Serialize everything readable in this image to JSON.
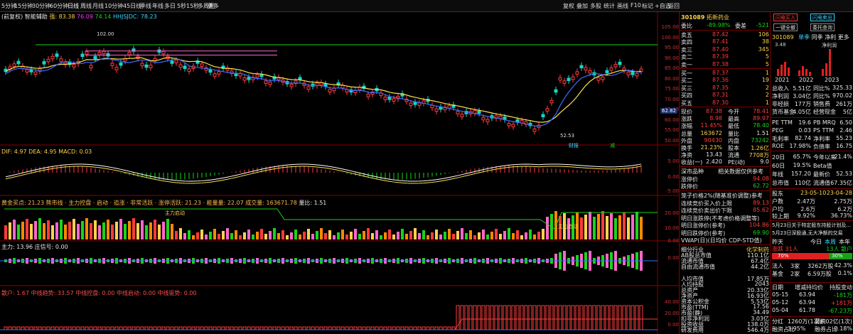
{
  "toolbar": {
    "periods": [
      "5分钟",
      "15分钟",
      "30分钟",
      "60分钟",
      "日线",
      "周线",
      "月线",
      "10分钟",
      "45日线",
      "季线",
      "年线",
      "多日",
      "5秒",
      "15秒",
      "多周期",
      "更多"
    ],
    "right": [
      "复权",
      "叠加",
      "多股",
      "统计",
      "画线",
      "F10",
      "标记",
      "+自选",
      "返回"
    ]
  },
  "header": {
    "title": "(前复权) 智能辅助",
    "ind1": "强: 83.38",
    "ind2": "76.09",
    "ind3": "74.14",
    "ind4": "HHJSJDC: 78.23"
  },
  "price_axis": [
    "105.00",
    "100.00",
    "95.00",
    "90.00",
    "85.00",
    "80.00",
    "75.00",
    "70.00",
    "65.00",
    "60.00",
    "55.00",
    "50.00"
  ],
  "price_marker": "62.82",
  "annotations": {
    "hi": "102.00",
    "lo": "52.53",
    "t1": "财报",
    "t2": "减"
  },
  "macd": {
    "label": "DIF: 4.97  DEA: 4.95  MACD: 0.03",
    "axis": [
      "5.00",
      "0.00",
      "-5.00"
    ]
  },
  "pane3": {
    "label": "黄金买点: 21.23  熊市线 · 主力控盘 · 启动 · 追涨 · 非常活跃 · 涨停活跃: 21.23 · 能量量: 22.07  成交量: 163671.78",
    "extra": "量比: 1.51",
    "axis": [
      "20.00",
      "10.00",
      "0.00"
    ],
    "tag1": "主力启动",
    "tag2": "主力启动"
  },
  "pane4": {
    "label": "主力: 13.96  庄信号: 0.00",
    "axis": [
      "0.00"
    ]
  },
  "pane5": {
    "label": "散户: 1.67  中线趋势: 33.57  中线控盘: 0.00  中线启动: 0.00  中线驱势: 0.00",
    "axis": [
      "40.00",
      "20.00",
      "0.00"
    ]
  },
  "rp": {
    "top_buttons": [
      "闪电买入",
      "闪电卖出",
      "一键全撤",
      "委托查询"
    ],
    "code": "301089",
    "name": "拓新药业",
    "weibi": {
      "label": "委比",
      "val": "-89.98%",
      "label2": "委差",
      "val2": "-521"
    },
    "asks": [
      {
        "lbl": "卖五",
        "p": "87.42",
        "v": "106"
      },
      {
        "lbl": "卖四",
        "p": "87.41",
        "v": "38"
      },
      {
        "lbl": "卖三",
        "p": "87.40",
        "v": "345"
      },
      {
        "lbl": "卖二",
        "p": "87.39",
        "v": "5"
      },
      {
        "lbl": "卖一",
        "p": "87.38",
        "v": "5"
      }
    ],
    "bids": [
      {
        "lbl": "买一",
        "p": "87.37",
        "v": "1"
      },
      {
        "lbl": "买二",
        "p": "87.36",
        "v": "19"
      },
      {
        "lbl": "买三",
        "p": "87.35",
        "v": "2"
      },
      {
        "lbl": "买四",
        "p": "87.31",
        "v": "2"
      },
      {
        "lbl": "买五",
        "p": "87.30",
        "v": "1"
      }
    ],
    "quote": [
      [
        "现价",
        "87.38",
        "今开",
        "78.41"
      ],
      [
        "涨跌",
        "8.98",
        "最高",
        "89.97"
      ],
      [
        "涨幅",
        "11.45%",
        "最低",
        "78.40"
      ],
      [
        "总量",
        "163672",
        "量比",
        "1.51"
      ],
      [
        "外盘",
        "90430",
        "内盘",
        "73242"
      ],
      [
        "换手",
        "21.23%",
        "股本",
        "1.26亿"
      ],
      [
        "净资",
        "13.43",
        "流通",
        "7708万"
      ],
      [
        "收益(一)",
        "2.420",
        "PE(动)",
        "9.0"
      ]
    ],
    "sz_label": "深市品种",
    "sz_note": "相关数据仅供参考",
    "limit_up_lbl": "涨停价",
    "limit_up": "94.08",
    "limit_dn_lbl": "跌停价",
    "limit_dn": "62.72",
    "auction": [
      [
        "笼子价格2%(随基准价调整)参考",
        ""
      ],
      [
        "连续竞价买入价上限",
        "89.13"
      ],
      [
        "连续竞价卖出价下限",
        "85.62"
      ],
      [
        "明日涨跌停(不考虑价格调整等)",
        ""
      ],
      [
        "明日涨停价(参考)",
        "104.86"
      ],
      [
        "明日跌停价(参考)",
        "69.90"
      ],
      [
        "VWAP(日)(日均价 CDP-STD值)",
        ""
      ]
    ],
    "industry": [
      [
        "细分行业",
        "化学制药"
      ],
      [
        "AB股总市值",
        "110.1亿"
      ],
      [
        "流通市值",
        "67.4亿"
      ],
      [
        "自由流通市值",
        "44.2亿"
      ],
      [
        "",
        ""
      ],
      [
        "人均市值",
        "17.85万"
      ],
      [
        "人均持股",
        "2043"
      ],
      [
        "总资产",
        "20.33亿"
      ],
      [
        "净资产",
        "16.93亿"
      ],
      [
        "资本公积金",
        "5.53亿"
      ],
      [
        "市盈(TTM)",
        "17.56"
      ],
      [
        "市盈(静)",
        "34.49"
      ],
      [
        "扣非净利润",
        "3.03亿"
      ],
      [
        "投资收益",
        "138.0万"
      ],
      [
        "研发费用",
        "546.4万"
      ]
    ],
    "fin_tabs": [
      "单季",
      "同季",
      "净利",
      "更多"
    ],
    "bar_labels": [
      "3.48",
      "净利润"
    ],
    "years": [
      "2021",
      "2022",
      "2023"
    ],
    "fin": [
      [
        "总收入",
        "5.51亿",
        "同比%",
        "325.33"
      ],
      [
        "净利润",
        "3.04亿",
        "同比%",
        "970.02"
      ],
      [
        "非经损",
        "177万",
        "销售费",
        "261万"
      ],
      [
        "货币基金",
        "4.05亿",
        "经营现金",
        "5亿"
      ]
    ],
    "fin2": [
      [
        "PE TTM",
        "19.6",
        "PB MRQ",
        "6.50"
      ],
      [
        "PEG",
        "0.03",
        "PS TTM",
        "2.46"
      ],
      [
        "毛利率",
        "82.74",
        "净利率",
        "55.23"
      ],
      [
        "ROE",
        "17.98%",
        "负债率",
        "16.75"
      ]
    ],
    "perf": [
      [
        "20日",
        "65.7%",
        "今年以来",
        "21.4%"
      ],
      [
        "60日",
        "19.5%",
        "Beta值",
        ""
      ],
      [
        "年线",
        "157.20",
        "最新价",
        "52.53"
      ],
      [
        "总市值",
        "110亿",
        "流通值",
        "67.35亿"
      ]
    ],
    "holders_hdr": [
      "股东",
      "23-05-10",
      "23-04-28"
    ],
    "holders": [
      [
        "户数",
        "2.47万",
        "2.75万"
      ],
      [
        "户均",
        "2.6万",
        "6.2万"
      ],
      [
        "较上期",
        "9.92%",
        "36.73%"
      ]
    ],
    "news": [
      "5月23日关于特定股东持股计划及...",
      "5月23日深股通,无大净额的交易"
    ],
    "flow_tabs": [
      "昨天",
      "今日",
      "本周",
      "本年"
    ],
    "flow_up": "涨跌 31人",
    "flow_dn": "13人 散户",
    "flow_pct_l": "70%",
    "flow_pct_r": "30%",
    "fund1": [
      "法人",
      "3家",
      "3262万股",
      "42.3%"
    ],
    "fund2": [
      "基金",
      "2家",
      "6.59万股",
      "0.1%"
    ],
    "trade_hdr": [
      "日期",
      "增减持均价",
      "持股变动"
    ],
    "trades": [
      [
        "05-15",
        "63.94",
        "-181万"
      ],
      [
        "05-12",
        "63.94",
        "+181万"
      ],
      [
        "05-04",
        "61.78",
        "-67.23万"
      ]
    ],
    "bottom1": [
      "分红",
      "1260万(1次)",
      "募资",
      "6.02亿(1次)"
    ],
    "bottom2": [
      "融资占比",
      "3.95%",
      "融券占比",
      "0.18%"
    ],
    "bottom3": [
      "融资余额",
      "融资余额",
      "融券余额"
    ]
  }
}
